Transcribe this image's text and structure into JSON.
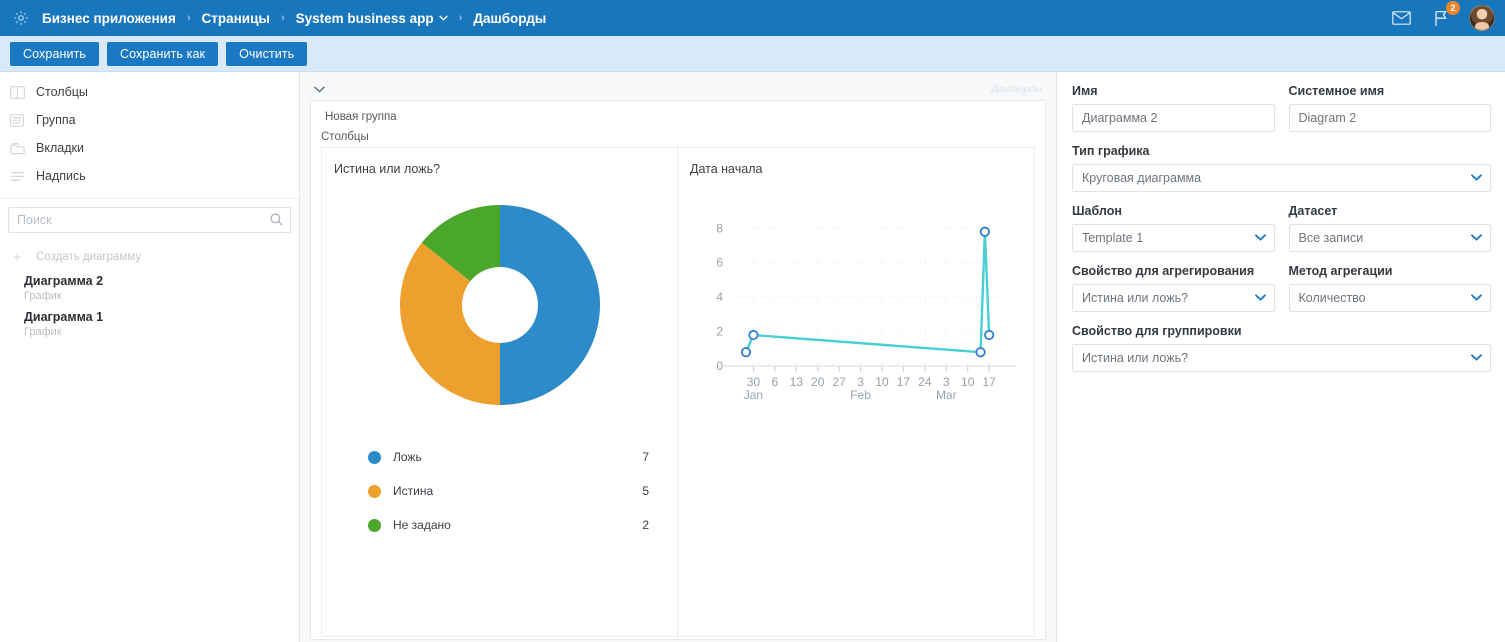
{
  "topbar": {
    "gear_icon": "gear-icon",
    "breadcrumbs": [
      {
        "label": "Бизнес приложения",
        "has_caret": false
      },
      {
        "label": "Страницы",
        "has_caret": false
      },
      {
        "label": "System business app",
        "has_caret": true
      },
      {
        "label": "Дашборды",
        "has_caret": false
      }
    ],
    "separator": "›",
    "mail_icon": "mail-icon",
    "flag_icon": "flag-icon",
    "flag_badge": "2",
    "avatar_icon": "user-avatar"
  },
  "actionbar": {
    "save_label": "Сохранить",
    "save_as_label": "Сохранить как",
    "clear_label": "Очистить"
  },
  "sidebar": {
    "palette": [
      {
        "label": "Столбцы",
        "icon": "columns-icon"
      },
      {
        "label": "Группа",
        "icon": "group-icon"
      },
      {
        "label": "Вкладки",
        "icon": "tabs-icon"
      },
      {
        "label": "Надпись",
        "icon": "label-icon"
      }
    ],
    "search": {
      "placeholder": "Поиск",
      "value": "",
      "icon": "search-icon"
    },
    "create_label": "Создать диаграмму",
    "charts": [
      {
        "name": "Диаграмма 2",
        "type": "График"
      },
      {
        "name": "Диаграмма 1",
        "type": "График"
      }
    ]
  },
  "canvas": {
    "collapse_icon": "chevron-down-icon",
    "watermark": "Дашборды",
    "group_title": "Новая группа",
    "columns_label": "Столбцы",
    "columns": [
      {
        "title": "Истина или ложь?"
      },
      {
        "title": "Дата начала"
      }
    ]
  },
  "rightpanel": {
    "name_label": "Имя",
    "name_value": "Диаграмма 2",
    "system_name_label": "Системное имя",
    "system_name_value": "Diagram 2",
    "chart_type_label": "Тип графика",
    "chart_type_value": "Круговая диаграмма",
    "template_label": "Шаблон",
    "template_value": "Template 1",
    "dataset_label": "Датасет",
    "dataset_value": "Все записи",
    "aggregation_property_label": "Свойство для агрегирования",
    "aggregation_property_value": "Истина или ложь?",
    "aggregation_method_label": "Метод агрегации",
    "aggregation_method_value": "Количество",
    "group_property_label": "Свойство для группировки",
    "group_property_value": "Истина или ложь?",
    "chevron_icon": "chevron-down-icon"
  },
  "colors": {
    "brand_blue": "#1876bd",
    "series_blue": "#2e8bc9",
    "series_orange": "#eda02e",
    "series_green": "#4ba72c",
    "line_cyan": "#49cfd4",
    "marker_blue": "#2f7fd0",
    "badge_orange": "#f0862b"
  },
  "chart_data": [
    {
      "type": "pie",
      "variant": "donut",
      "title": "Истина или ложь?",
      "labels": [
        "Ложь",
        "Истина",
        "Не задано"
      ],
      "values": [
        7,
        5,
        2
      ],
      "colors": [
        "#2e8bc9",
        "#eda02e",
        "#4ba72c"
      ],
      "total": 14,
      "hole_ratio": 0.38,
      "start_angle_deg": 0,
      "direction": "clockwise",
      "legend_position": "bottom-left"
    },
    {
      "type": "line",
      "title": "Дата начала",
      "xlabel": "",
      "ylabel": "",
      "ylim": [
        0,
        8.6
      ],
      "yticks": [
        0,
        2,
        4,
        6,
        8
      ],
      "grid": true,
      "x_tick_labels": [
        "30",
        "6",
        "13",
        "20",
        "27",
        "3",
        "10",
        "17",
        "24",
        "3",
        "10",
        "17"
      ],
      "x_month_labels": [
        {
          "label": "Jan",
          "at_tick": 0
        },
        {
          "label": "Feb",
          "at_tick": 5
        },
        {
          "label": "Mar",
          "at_tick": 9
        }
      ],
      "points": [
        {
          "x": -0.35,
          "y": 0.8
        },
        {
          "x": 0.0,
          "y": 1.8
        },
        {
          "x": 10.6,
          "y": 0.8
        },
        {
          "x": 10.8,
          "y": 7.8
        },
        {
          "x": 11.0,
          "y": 1.8
        }
      ],
      "line_color": "#49cfd4",
      "marker_color": "#2f7fd0"
    }
  ]
}
